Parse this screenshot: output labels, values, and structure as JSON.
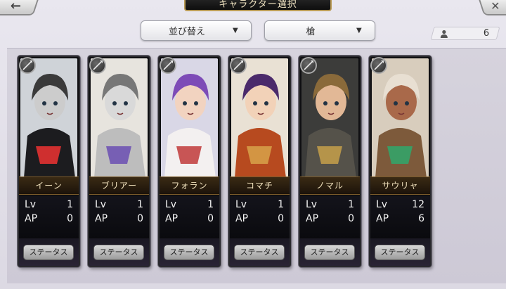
{
  "header": {
    "back_glyph": "←",
    "close_glyph": "✕",
    "title": "キャラクター選択"
  },
  "filters": {
    "sort_label": "並び替え",
    "weapon_label": "槍",
    "arrow": "▼"
  },
  "party": {
    "count": "6"
  },
  "colors": {
    "accent_gold": "#b99a55",
    "card_bg": "#0f0f12"
  },
  "characters": [
    {
      "name": "イーン",
      "lv_label": "Lv",
      "lv": "1",
      "ap_label": "AP",
      "ap": "0",
      "status_label": "ステータス",
      "weapon_icon": "spear-icon"
    },
    {
      "name": "ブリアー",
      "lv_label": "Lv",
      "lv": "1",
      "ap_label": "AP",
      "ap": "0",
      "status_label": "ステータス",
      "weapon_icon": "spear-icon"
    },
    {
      "name": "フォラン",
      "lv_label": "Lv",
      "lv": "1",
      "ap_label": "AP",
      "ap": "0",
      "status_label": "ステータス",
      "weapon_icon": "spear-icon"
    },
    {
      "name": "コマチ",
      "lv_label": "Lv",
      "lv": "1",
      "ap_label": "AP",
      "ap": "0",
      "status_label": "ステータス",
      "weapon_icon": "spear-icon"
    },
    {
      "name": "ノマル",
      "lv_label": "Lv",
      "lv": "1",
      "ap_label": "AP",
      "ap": "0",
      "status_label": "ステータス",
      "weapon_icon": "spear-icon"
    },
    {
      "name": "サウリャ",
      "lv_label": "Lv",
      "lv": "12",
      "ap_label": "AP",
      "ap": "6",
      "status_label": "ステータス",
      "weapon_icon": "spear-icon"
    }
  ]
}
